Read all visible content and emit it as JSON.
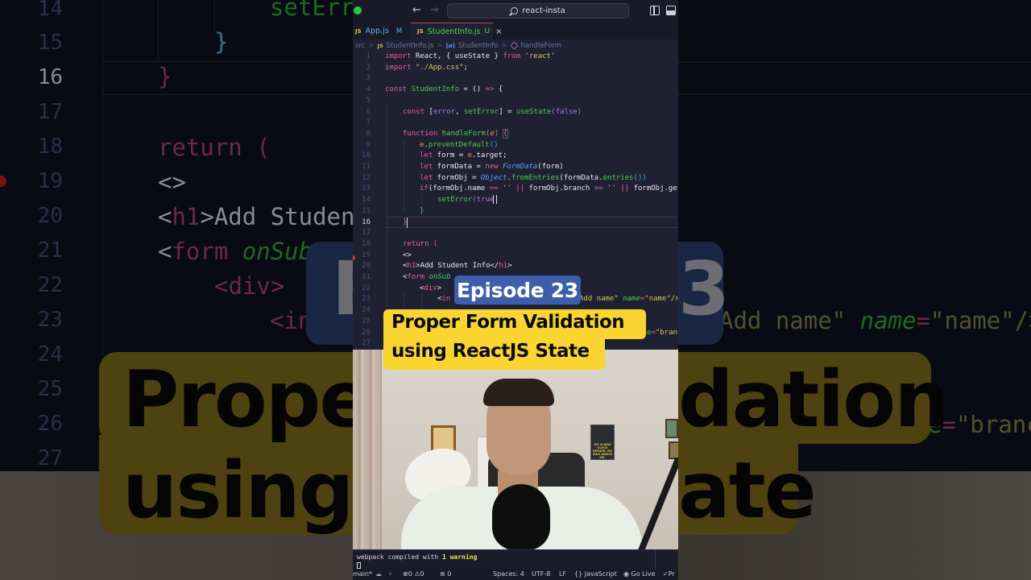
{
  "titlebar": {
    "search_text": "react-insta",
    "back_icon": "arrow-left-icon",
    "forward_icon": "arrow-right-icon"
  },
  "tabs": [
    {
      "icon": "JS",
      "label": "App.js",
      "badge": "M",
      "active": false
    },
    {
      "icon": "JS",
      "label": "StudentInfo.js",
      "badge": "U",
      "active": true,
      "close": "×"
    }
  ],
  "breadcrumb": {
    "items": [
      "src",
      "StudentInfo.js",
      "StudentInfo",
      "handleForm"
    ],
    "separator": ">",
    "file_icon": "JS",
    "var_icon": "[ø]"
  },
  "editor": {
    "current_line": 16,
    "line_numbers": [
      "1",
      "2",
      "3",
      "4",
      "5",
      "6",
      "7",
      "8",
      "9",
      "10",
      "11",
      "12",
      "13",
      "14",
      "15",
      "16",
      "17",
      "18",
      "19",
      "20",
      "21",
      "22",
      "23",
      "24",
      "25",
      "26",
      "27"
    ],
    "lines": {
      "l1": [
        "import",
        " React, { ",
        "useState",
        " } ",
        "from",
        " ",
        "'react'"
      ],
      "l2": [
        "import",
        " ",
        "\"./App.css\"",
        ";"
      ],
      "l4": [
        "const",
        " ",
        "StudentInfo",
        " = () ",
        "=>",
        " {"
      ],
      "l6": [
        "const",
        " [",
        "error",
        ", ",
        "setError",
        "] = ",
        "useState",
        "(",
        "false",
        ")"
      ],
      "l8": [
        "function",
        " ",
        "handleForm",
        "(",
        "e",
        ") ",
        "{"
      ],
      "l9": [
        "e",
        ".",
        "preventDefault",
        "()"
      ],
      "l10": [
        "let",
        " form = ",
        "e",
        ".target;"
      ],
      "l11": [
        "let",
        " formData = ",
        "new",
        " ",
        "FormData",
        "(form)"
      ],
      "l12": [
        "let",
        " formObj = ",
        "Object",
        ".",
        "fromEntries",
        "(formData.",
        "entries",
        "())"
      ],
      "l13": [
        "if",
        "(formObj.name ",
        "==",
        " '' ",
        "||",
        " formObj.branch ",
        "==",
        " '' ",
        "||",
        " formObj.ge"
      ],
      "l14": [
        "setError",
        "(",
        "true"
      ],
      "l15": [
        "}"
      ],
      "l16": [
        "}"
      ],
      "l18": [
        "return",
        " ("
      ],
      "l19": [
        "<>"
      ],
      "l20": [
        "<",
        "h1",
        ">Add Student Info</",
        "h1",
        ">"
      ],
      "l21": [
        "<",
        "form",
        " ",
        "onSub"
      ],
      "l22": [
        "<",
        "div",
        ">"
      ],
      "l23a": [
        "<",
        "in"
      ],
      "l23b": [
        "Add name\" ",
        "name",
        "=",
        "\"name\"/>"
      ],
      "l26": [
        "e",
        "=",
        "\"branc"
      ]
    }
  },
  "overlay": {
    "episode": "Episode 23",
    "title_line1": "Proper Form Validation",
    "title_line2": "using ReactJS State"
  },
  "webcam": {
    "poster_text": "NO ALARM CLOCK NEEDED. MY IDEA WAKES ME."
  },
  "terminal": {
    "prefix": "webpack compiled with ",
    "warning": "1 warning"
  },
  "statusbar": {
    "branch": "main*",
    "errors": "0",
    "warnings": "0",
    "ports": "0",
    "spaces": "Spaces: 4",
    "encoding": "UTF-8",
    "eol": "LF",
    "language": "JavaScript",
    "golive": "Go Live",
    "prettier": "Pr"
  },
  "background": {
    "line_numbers": [
      "14",
      "15",
      "16",
      "17",
      "18",
      "19",
      "20",
      "21",
      "22",
      "23",
      "24",
      "25",
      "26",
      "27"
    ],
    "code_fragments": {
      "l14": "setErr",
      "l15": "}",
      "l16": "}",
      "l18": "return (",
      "l19": "<>",
      "l20a": "<",
      "l20b": "h1",
      "l20c": ">Add Studen",
      "l21a": "<",
      "l21b": "form",
      "l21c": " onSub",
      "l22": "<div>",
      "l23": "<in",
      "l23r_a": "Add name\" ",
      "l23r_b": "name",
      "l23r_c": "=",
      "l23r_d": "\"name\"/>",
      "l26r_a": "e",
      "l26r_b": "=",
      "l26r_c": "\"branc"
    },
    "episode_fragment_left": "E",
    "episode_fragment_right": "3",
    "title_left_1": "Proper",
    "title_left_2": "using R",
    "title_right_1": "dation",
    "title_right_2": "ate"
  }
}
